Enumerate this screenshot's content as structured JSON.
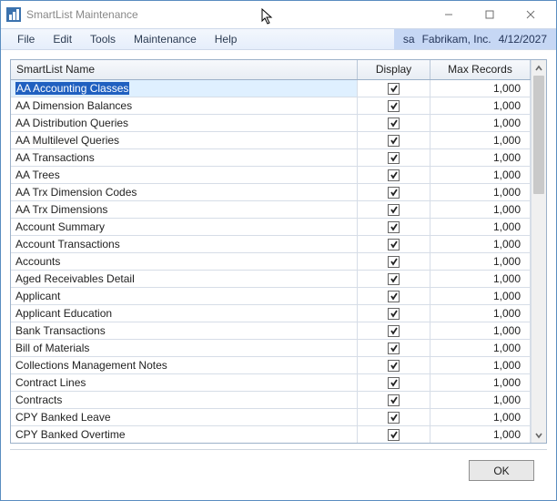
{
  "window": {
    "title": "SmartList Maintenance"
  },
  "menu": {
    "items": [
      "File",
      "Edit",
      "Tools",
      "Maintenance",
      "Help"
    ]
  },
  "status": {
    "user": "sa",
    "company": "Fabrikam, Inc.",
    "date": "4/12/2027"
  },
  "grid": {
    "columns": {
      "name": "SmartList Name",
      "display": "Display",
      "max": "Max Records"
    },
    "rows": [
      {
        "name": "AA Accounting Classes",
        "display": true,
        "max": "1,000",
        "selected": true
      },
      {
        "name": "AA Dimension Balances",
        "display": true,
        "max": "1,000"
      },
      {
        "name": "AA Distribution Queries",
        "display": true,
        "max": "1,000"
      },
      {
        "name": "AA Multilevel Queries",
        "display": true,
        "max": "1,000"
      },
      {
        "name": "AA Transactions",
        "display": true,
        "max": "1,000"
      },
      {
        "name": "AA Trees",
        "display": true,
        "max": "1,000"
      },
      {
        "name": "AA Trx Dimension Codes",
        "display": true,
        "max": "1,000"
      },
      {
        "name": "AA Trx Dimensions",
        "display": true,
        "max": "1,000"
      },
      {
        "name": "Account Summary",
        "display": true,
        "max": "1,000"
      },
      {
        "name": "Account Transactions",
        "display": true,
        "max": "1,000"
      },
      {
        "name": "Accounts",
        "display": true,
        "max": "1,000"
      },
      {
        "name": "Aged Receivables Detail",
        "display": true,
        "max": "1,000"
      },
      {
        "name": "Applicant",
        "display": true,
        "max": "1,000"
      },
      {
        "name": "Applicant Education",
        "display": true,
        "max": "1,000"
      },
      {
        "name": "Bank Transactions",
        "display": true,
        "max": "1,000"
      },
      {
        "name": "Bill of Materials",
        "display": true,
        "max": "1,000"
      },
      {
        "name": "Collections Management Notes",
        "display": true,
        "max": "1,000"
      },
      {
        "name": "Contract Lines",
        "display": true,
        "max": "1,000"
      },
      {
        "name": "Contracts",
        "display": true,
        "max": "1,000"
      },
      {
        "name": "CPY Banked Leave",
        "display": true,
        "max": "1,000"
      },
      {
        "name": "CPY Banked Overtime",
        "display": true,
        "max": "1,000"
      }
    ]
  },
  "buttons": {
    "ok": "OK"
  }
}
